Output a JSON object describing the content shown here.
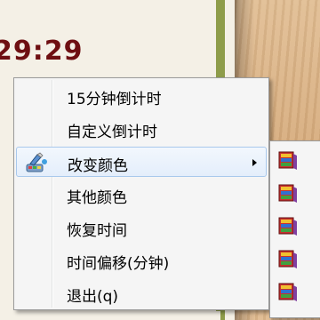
{
  "timer": {
    "display": "29:29"
  },
  "menu": {
    "items": [
      {
        "label": "15分钟倒计时",
        "icon": "",
        "has_submenu": false
      },
      {
        "label": "自定义倒计时",
        "icon": "",
        "has_submenu": false
      },
      {
        "label": "改变颜色",
        "icon": "paint-palette-icon",
        "has_submenu": true
      },
      {
        "label": "其他颜色",
        "icon": "",
        "has_submenu": false
      },
      {
        "label": "恢复时间",
        "icon": "",
        "has_submenu": false
      },
      {
        "label": "时间偏移(分钟)",
        "icon": "",
        "has_submenu": false
      },
      {
        "label": "退出(q)",
        "icon": "",
        "has_submenu": false
      }
    ]
  },
  "submenu": {
    "items": [
      {
        "icon": "color-book-icon"
      },
      {
        "icon": "color-book-icon"
      },
      {
        "icon": "color-book-icon"
      },
      {
        "icon": "color-book-icon"
      },
      {
        "icon": "color-book-icon"
      }
    ]
  },
  "colors": {
    "timer_text": "#6e0f12",
    "frame_border": "#8e9c49",
    "menu_hover_border": "#a8c8ec"
  }
}
